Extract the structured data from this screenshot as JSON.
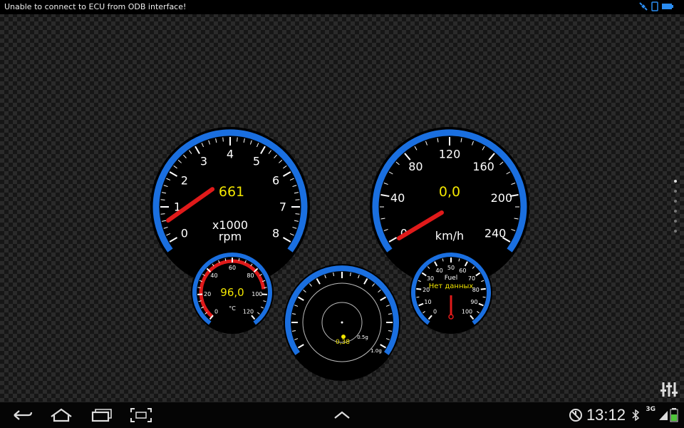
{
  "status_bar": {
    "message": "Unable to connect to ECU from ODB interface!",
    "icons": [
      "gps-icon",
      "phone-icon",
      "battery-icon"
    ]
  },
  "tachometer": {
    "labels": [
      "0",
      "1",
      "2",
      "3",
      "4",
      "5",
      "6",
      "7",
      "8"
    ],
    "value": "661",
    "unit_top": "x1000",
    "unit_bottom": "rpm",
    "reading": 0.661
  },
  "speedometer": {
    "labels": [
      "0",
      "40",
      "80",
      "120",
      "160",
      "200",
      "240"
    ],
    "value": "0,0",
    "unit": "km/h",
    "reading": 0
  },
  "coolant": {
    "labels": [
      "0",
      "20",
      "40",
      "60",
      "80",
      "100",
      "120"
    ],
    "value": "96,0",
    "unit": "°C",
    "reading": 96
  },
  "accelerometer": {
    "value": "0,38",
    "ring_half": "0.5g",
    "ring_full": "1.0g"
  },
  "fuel": {
    "labels": [
      "0",
      "10",
      "20",
      "30",
      "40",
      "50",
      "60",
      "70",
      "80",
      "90",
      "100"
    ],
    "title": "Fuel",
    "value": "Нет данных"
  },
  "nav_bar": {
    "time": "13:12",
    "network": "3G"
  },
  "pager": {
    "count": 6,
    "active": 0
  },
  "colors": {
    "bezel_blue": "#1a6fe0",
    "needle_red": "#e01a1a",
    "value_yellow": "#f2e600",
    "face": "#000000"
  }
}
